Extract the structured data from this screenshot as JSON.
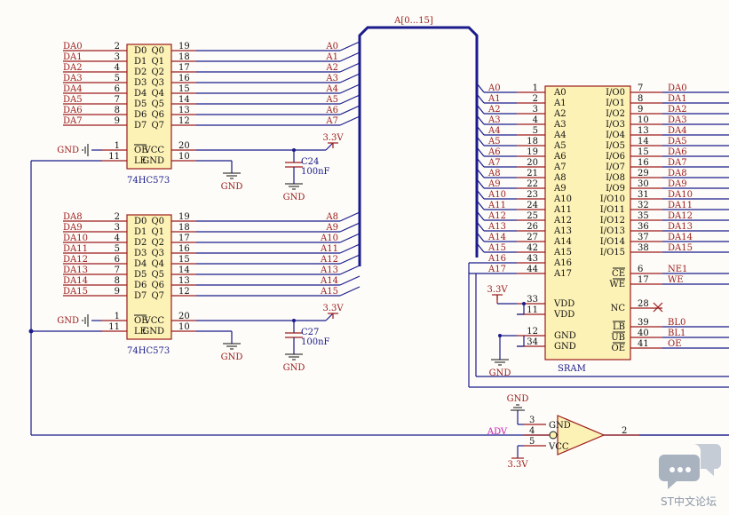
{
  "latch1": {
    "part": "74HC573",
    "left_pins": [
      {
        "num": "2",
        "name": "D0",
        "net": "DA0"
      },
      {
        "num": "3",
        "name": "D1",
        "net": "DA1"
      },
      {
        "num": "4",
        "name": "D2",
        "net": "DA2"
      },
      {
        "num": "5",
        "name": "D3",
        "net": "DA3"
      },
      {
        "num": "6",
        "name": "D4",
        "net": "DA4"
      },
      {
        "num": "7",
        "name": "D5",
        "net": "DA5"
      },
      {
        "num": "8",
        "name": "D6",
        "net": "DA6"
      },
      {
        "num": "9",
        "name": "D7",
        "net": "DA7"
      },
      {
        "num": "1",
        "name": "OE",
        "net": "GND"
      },
      {
        "num": "11",
        "name": "LE",
        "net": ""
      }
    ],
    "right_pins": [
      {
        "num": "19",
        "name": "Q0",
        "net": "A0"
      },
      {
        "num": "18",
        "name": "Q1",
        "net": "A1"
      },
      {
        "num": "17",
        "name": "Q2",
        "net": "A2"
      },
      {
        "num": "16",
        "name": "Q3",
        "net": "A3"
      },
      {
        "num": "15",
        "name": "Q4",
        "net": "A4"
      },
      {
        "num": "14",
        "name": "Q5",
        "net": "A5"
      },
      {
        "num": "13",
        "name": "Q6",
        "net": "A6"
      },
      {
        "num": "12",
        "name": "Q7",
        "net": "A7"
      },
      {
        "num": "20",
        "name": "VCC",
        "net": "3.3V"
      },
      {
        "num": "10",
        "name": "GND",
        "net": "GND"
      }
    ],
    "cap": {
      "ref": "C24",
      "value": "100nF"
    }
  },
  "latch2": {
    "part": "74HC573",
    "left_pins": [
      {
        "num": "2",
        "name": "D0",
        "net": "DA8"
      },
      {
        "num": "3",
        "name": "D1",
        "net": "DA9"
      },
      {
        "num": "4",
        "name": "D2",
        "net": "DA10"
      },
      {
        "num": "5",
        "name": "D3",
        "net": "DA11"
      },
      {
        "num": "6",
        "name": "D4",
        "net": "DA12"
      },
      {
        "num": "7",
        "name": "D5",
        "net": "DA13"
      },
      {
        "num": "8",
        "name": "D6",
        "net": "DA14"
      },
      {
        "num": "9",
        "name": "D7",
        "net": "DA15"
      },
      {
        "num": "1",
        "name": "OE",
        "net": "GND"
      },
      {
        "num": "11",
        "name": "LE",
        "net": ""
      }
    ],
    "right_pins": [
      {
        "num": "19",
        "name": "Q0",
        "net": "A8"
      },
      {
        "num": "18",
        "name": "Q1",
        "net": "A9"
      },
      {
        "num": "17",
        "name": "Q2",
        "net": "A10"
      },
      {
        "num": "16",
        "name": "Q3",
        "net": "A11"
      },
      {
        "num": "15",
        "name": "Q4",
        "net": "A12"
      },
      {
        "num": "14",
        "name": "Q5",
        "net": "A13"
      },
      {
        "num": "13",
        "name": "Q6",
        "net": "A14"
      },
      {
        "num": "12",
        "name": "Q7",
        "net": "A15"
      },
      {
        "num": "20",
        "name": "VCC",
        "net": "3.3V"
      },
      {
        "num": "10",
        "name": "GND",
        "net": "GND"
      }
    ],
    "cap": {
      "ref": "C27",
      "value": "100nF"
    }
  },
  "bus_label": "A[0...15]",
  "sram": {
    "label": "SRAM",
    "left_pins": [
      {
        "num": "1",
        "name": "A0",
        "net": "A0"
      },
      {
        "num": "2",
        "name": "A1",
        "net": "A1"
      },
      {
        "num": "3",
        "name": "A2",
        "net": "A2"
      },
      {
        "num": "4",
        "name": "A3",
        "net": "A3"
      },
      {
        "num": "5",
        "name": "A4",
        "net": "A4"
      },
      {
        "num": "18",
        "name": "A5",
        "net": "A5"
      },
      {
        "num": "19",
        "name": "A6",
        "net": "A6"
      },
      {
        "num": "20",
        "name": "A7",
        "net": "A7"
      },
      {
        "num": "21",
        "name": "A8",
        "net": "A8"
      },
      {
        "num": "22",
        "name": "A9",
        "net": "A9"
      },
      {
        "num": "23",
        "name": "A10",
        "net": "A10"
      },
      {
        "num": "24",
        "name": "A11",
        "net": "A11"
      },
      {
        "num": "25",
        "name": "A12",
        "net": "A12"
      },
      {
        "num": "26",
        "name": "A13",
        "net": "A13"
      },
      {
        "num": "27",
        "name": "A14",
        "net": "A14"
      },
      {
        "num": "42",
        "name": "A15",
        "net": "A15"
      },
      {
        "num": "43",
        "name": "A16",
        "net": "A16"
      },
      {
        "num": "44",
        "name": "A17",
        "net": "A17"
      }
    ],
    "right_pins": [
      {
        "num": "7",
        "name": "I/O0",
        "net": "DA0"
      },
      {
        "num": "8",
        "name": "I/O1",
        "net": "DA1"
      },
      {
        "num": "9",
        "name": "I/O2",
        "net": "DA2"
      },
      {
        "num": "10",
        "name": "I/O3",
        "net": "DA3"
      },
      {
        "num": "13",
        "name": "I/O4",
        "net": "DA4"
      },
      {
        "num": "14",
        "name": "I/O5",
        "net": "DA5"
      },
      {
        "num": "15",
        "name": "I/O6",
        "net": "DA6"
      },
      {
        "num": "16",
        "name": "I/O7",
        "net": "DA7"
      },
      {
        "num": "29",
        "name": "I/O8",
        "net": "DA8"
      },
      {
        "num": "30",
        "name": "I/O9",
        "net": "DA9"
      },
      {
        "num": "31",
        "name": "I/O10",
        "net": "DA10"
      },
      {
        "num": "32",
        "name": "I/O11",
        "net": "DA11"
      },
      {
        "num": "35",
        "name": "I/O12",
        "net": "DA12"
      },
      {
        "num": "36",
        "name": "I/O13",
        "net": "DA13"
      },
      {
        "num": "37",
        "name": "I/O14",
        "net": "DA14"
      },
      {
        "num": "38",
        "name": "I/O15",
        "net": "DA15"
      }
    ],
    "ctrl_pins": [
      {
        "num": "6",
        "name": "CE",
        "net": "NE1"
      },
      {
        "num": "17",
        "name": "WE",
        "net": "WE"
      },
      {
        "num": "28",
        "name": "NC",
        "net": ""
      },
      {
        "num": "39",
        "name": "LB",
        "net": "BL0"
      },
      {
        "num": "40",
        "name": "UB",
        "net": "BL1"
      },
      {
        "num": "41",
        "name": "OE",
        "net": "OE"
      }
    ],
    "power_pins": [
      {
        "num": "33",
        "name": "VDD"
      },
      {
        "num": "11",
        "name": "VDD"
      },
      {
        "num": "12",
        "name": "GND"
      },
      {
        "num": "34",
        "name": "GND"
      }
    ]
  },
  "inverter": {
    "net_in": "ADV",
    "pins": [
      {
        "num": "3",
        "name": "GND"
      },
      {
        "num": "4",
        "name": ""
      },
      {
        "num": "5",
        "name": "VCC"
      },
      {
        "num": "2",
        "name": ""
      }
    ]
  },
  "power_labels": {
    "gnd": "GND",
    "vcc": "3.3V"
  },
  "watermark": "ST中文论坛"
}
